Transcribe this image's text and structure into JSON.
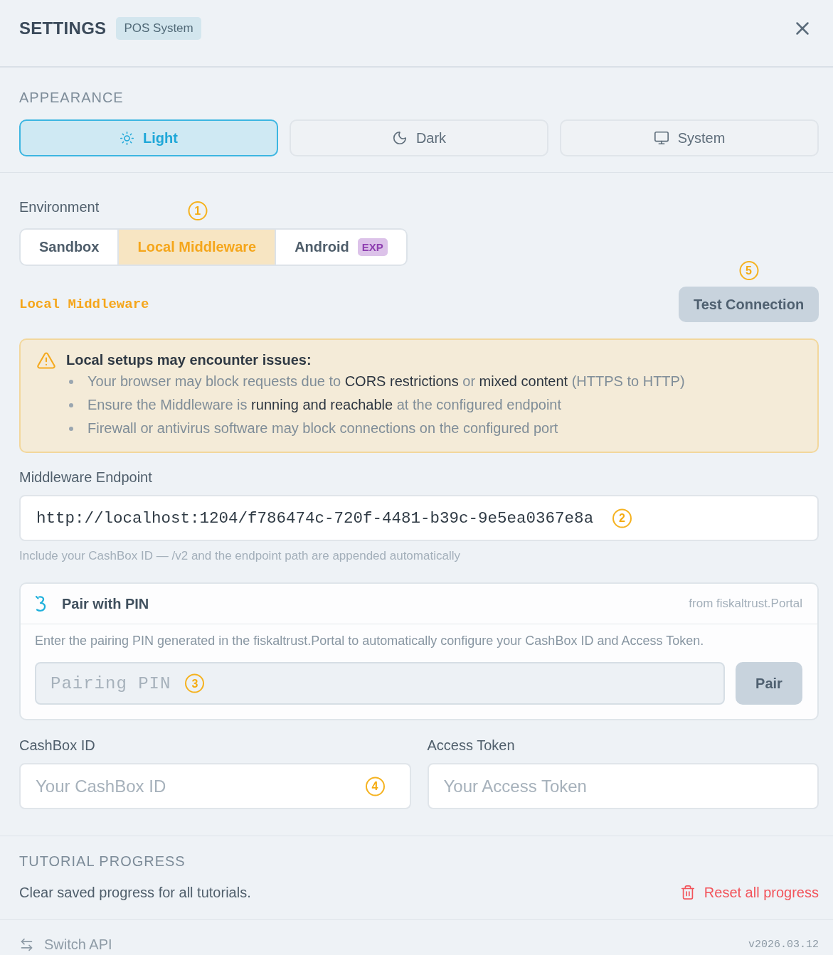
{
  "window": {
    "title": "SETTINGS",
    "badge": "POS System"
  },
  "appearance": {
    "heading": "APPEARANCE",
    "options": [
      {
        "kind": "light",
        "label": "Light",
        "selected": true
      },
      {
        "kind": "dark",
        "label": "Dark",
        "selected": false
      },
      {
        "kind": "system",
        "label": "System",
        "selected": false
      }
    ]
  },
  "environment": {
    "label": "Environment",
    "tabs": [
      {
        "label": "Sandbox",
        "selected": false
      },
      {
        "label": "Local Middleware",
        "selected": true,
        "marker": "1"
      },
      {
        "label": "Android",
        "selected": false,
        "badge": "EXP"
      }
    ]
  },
  "connection": {
    "mode_label": "Local Middleware",
    "test_button": "Test Connection",
    "marker": "5"
  },
  "warning": {
    "title": "Local setups may encounter issues:",
    "items": [
      "Your browser may block requests due to **CORS restrictions** or **mixed content** (HTTPS to HTTP)",
      "Ensure the Middleware is **running and reachable** at the configured endpoint",
      "Firewall or antivirus software may block connections on the configured port"
    ]
  },
  "endpoint": {
    "label": "Middleware Endpoint",
    "value": "http://localhost:1204/f786474c-720f-4481-b39c-9e5ea0367e8a",
    "marker": "2",
    "hint": "Include your CashBox ID — /v2 and the endpoint path are appended automatically"
  },
  "pairing": {
    "title": "Pair with PIN",
    "source": "from fiskaltrust.Portal",
    "description": "Enter the pairing PIN generated in the fiskaltrust.Portal to automatically configure your CashBox ID and Access Token.",
    "pin": {
      "placeholder": "Pairing PIN",
      "marker": "3"
    },
    "button": "Pair"
  },
  "credentials": [
    {
      "label": "CashBox ID",
      "placeholder": "Your CashBox ID",
      "marker": "4"
    },
    {
      "label": "Access Token",
      "placeholder": "Your Access Token"
    }
  ],
  "tutorial": {
    "heading": "TUTORIAL PROGRESS",
    "description": "Clear saved progress for all tutorials.",
    "reset_button": "Reset all progress"
  },
  "footer": {
    "switch_button": "Switch API",
    "version": "v2026.03.12"
  }
}
